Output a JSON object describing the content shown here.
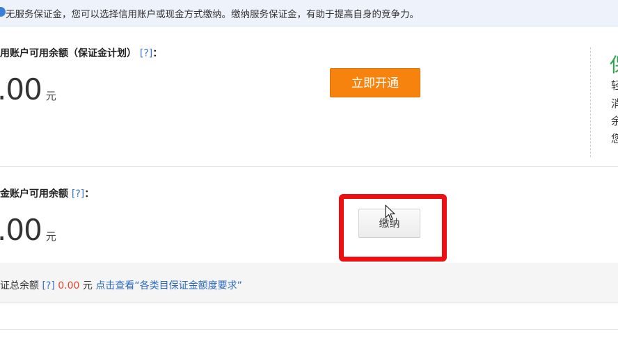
{
  "notice": {
    "text": "无服务保证金，您可以选择信用账户或现金方式缴纳。缴纳服务保证金，有助于提高自身的竞争力。"
  },
  "credit_account": {
    "label": "用账户可用余额（保证金计划）",
    "help": "[?]",
    "colon": "：",
    "amount": ".00",
    "unit": "元",
    "button_label": "立即开通"
  },
  "cash_account": {
    "label": "金账户可用余额",
    "help": "[?]",
    "colon": "：",
    "amount": ".00",
    "unit": "元",
    "button_label": "缴纳"
  },
  "summary": {
    "label": "证总余额",
    "help": "[?]",
    "amount": "0.00",
    "unit": "元",
    "link_text": "点击查看“各类目保证金额度要求”"
  },
  "right_panel": {
    "title_glyph": "保",
    "lines": [
      "轻",
      "消",
      "余",
      "您"
    ]
  },
  "colors": {
    "accent_orange": "#f7830f",
    "highlight_red": "#ee0f12",
    "link_blue": "#2b6bbf",
    "amount_red": "#e8432e",
    "title_green": "#2aa34a"
  }
}
